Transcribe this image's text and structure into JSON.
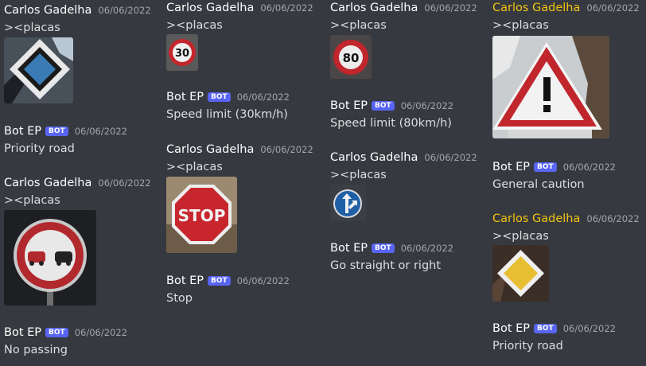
{
  "messages": {
    "c1": {
      "m1": {
        "author": "Carlos Gadelha",
        "time": "06/06/2022",
        "text": "><placas"
      },
      "b1": {
        "author": "Bot EP",
        "badge": "BOT",
        "time": "06/06/2022",
        "text": "Priority road"
      },
      "m2": {
        "author": "Carlos Gadelha",
        "time": "06/06/2022",
        "text": "><placas"
      },
      "b2": {
        "author": "Bot EP",
        "badge": "BOT",
        "time": "06/06/2022",
        "text": "No passing"
      }
    },
    "c2": {
      "m1": {
        "author": "Carlos Gadelha",
        "time": "06/06/2022",
        "text": "><placas"
      },
      "sign_number": "30",
      "b1": {
        "author": "Bot EP",
        "badge": "BOT",
        "time": "06/06/2022",
        "text": "Speed limit (30km/h)"
      },
      "m2": {
        "author": "Carlos Gadelha",
        "time": "06/06/2022",
        "text": "><placas"
      },
      "stop_label": "STOP",
      "b2": {
        "author": "Bot EP",
        "badge": "BOT",
        "time": "06/06/2022",
        "text": "Stop"
      }
    },
    "c3": {
      "m1": {
        "author": "Carlos Gadelha",
        "time": "06/06/2022",
        "text": "><placas"
      },
      "sign_number": "80",
      "b1": {
        "author": "Bot EP",
        "badge": "BOT",
        "time": "06/06/2022",
        "text": "Speed limit (80km/h)"
      },
      "m2": {
        "author": "Carlos Gadelha",
        "time": "06/06/2022",
        "text": "><placas"
      },
      "b2": {
        "author": "Bot EP",
        "badge": "BOT",
        "time": "06/06/2022",
        "text": "Go straight or right"
      }
    },
    "c4": {
      "m1": {
        "author": "Carlos Gadelha",
        "time": "06/06/2022",
        "text": "><placas"
      },
      "b1": {
        "author": "Bot EP",
        "badge": "BOT",
        "time": "06/06/2022",
        "text": "General caution"
      },
      "m2": {
        "author": "Carlos Gadelha",
        "time": "06/06/2022",
        "text": "><placas"
      },
      "b2": {
        "author": "Bot EP",
        "badge": "BOT",
        "time": "06/06/2022",
        "text": "Priority road"
      }
    }
  },
  "colors": {
    "background": "#36393f",
    "username_default": "#ffffff",
    "username_highlight": "#f1c40f",
    "bot_badge": "#5865f2",
    "timestamp": "#a3a6aa",
    "message_text": "#dcddde"
  },
  "icons": {
    "sign1": "priority-road-sign-icon",
    "sign2": "no-passing-sign-icon",
    "sign3": "speed-limit-30-sign-icon",
    "sign4": "stop-sign-icon",
    "sign5": "speed-limit-80-sign-icon",
    "sign6": "go-straight-or-right-sign-icon",
    "sign7": "general-caution-sign-icon",
    "sign8": "priority-road-sign-icon"
  }
}
